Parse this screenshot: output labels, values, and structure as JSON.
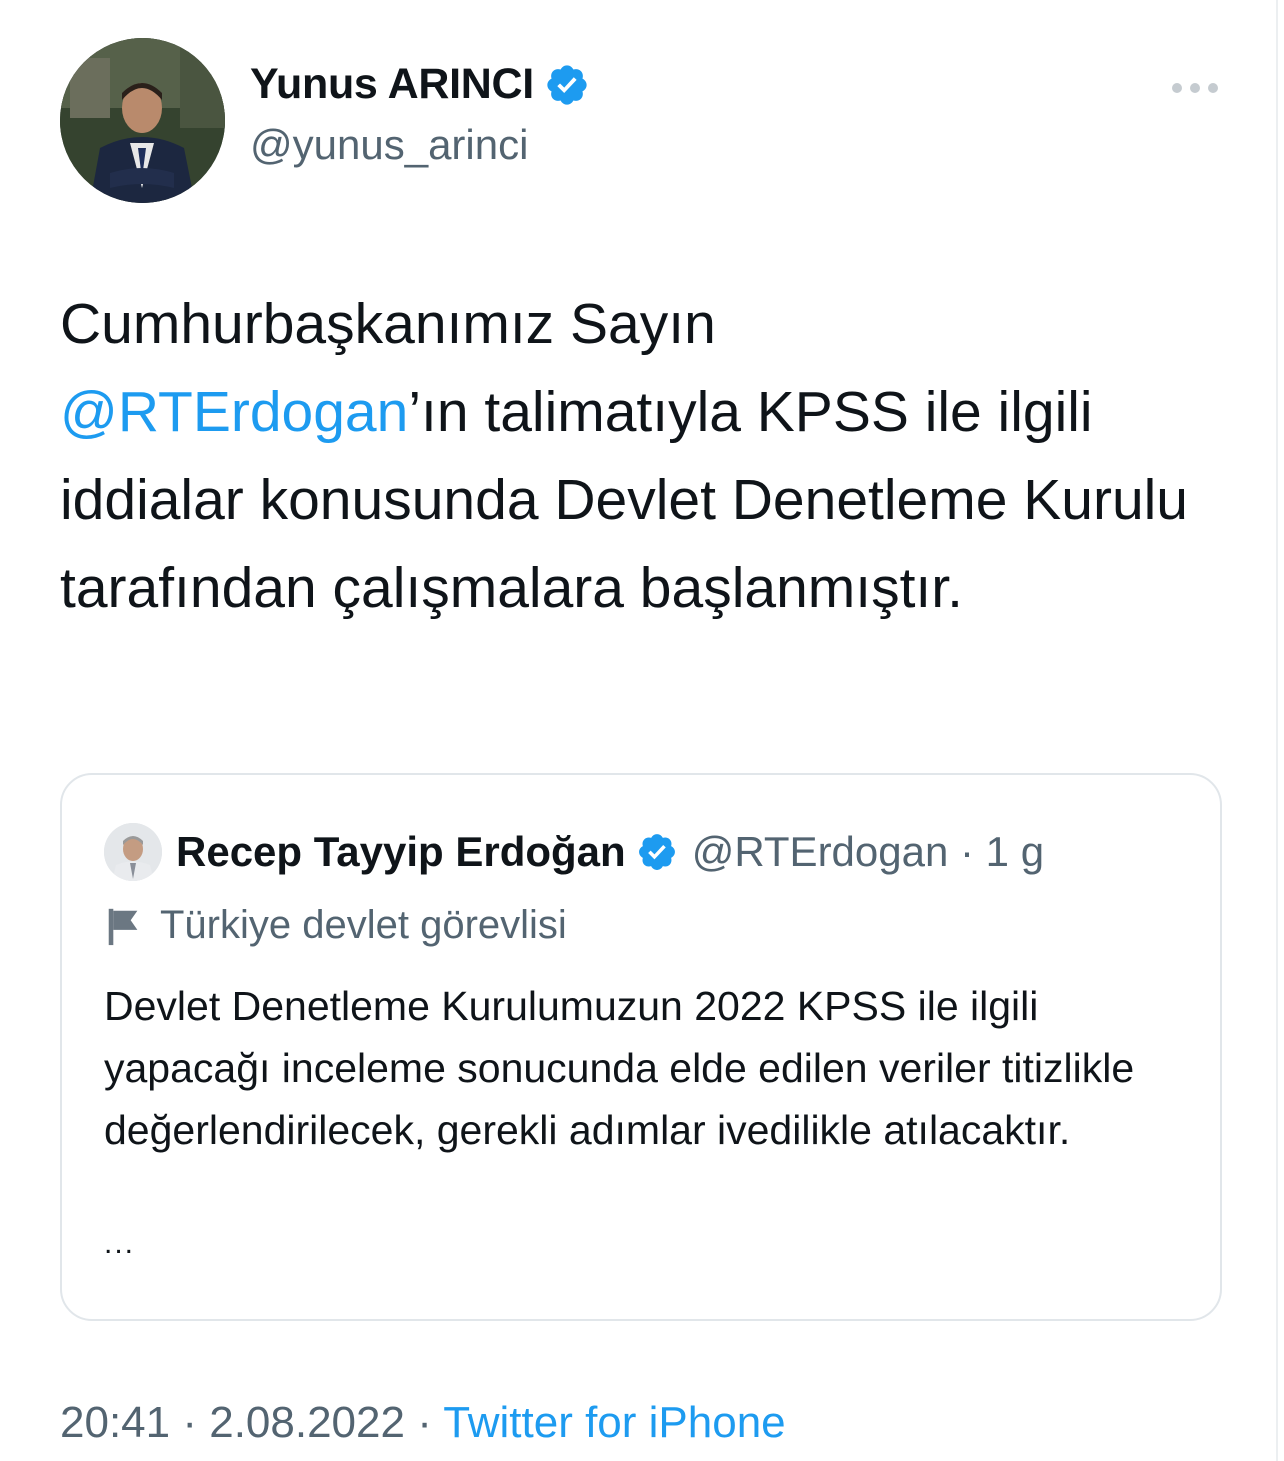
{
  "author": {
    "display_name": "Yunus ARINCI",
    "handle": "@yunus_arinci",
    "verified_icon": "verified-badge-icon",
    "more_icon": "more-horizontal-icon"
  },
  "tweet": {
    "text_before_mention": "Cumhurbaşkanımız Sayın ",
    "mention": "@RTErdogan",
    "text_after_mention": "’ın talimatıyla KPSS ile ilgili iddialar konusunda Devlet Denetleme Kurulu tarafından çalışmalara başlanmıştır."
  },
  "quoted_tweet": {
    "display_name": "Recep Tayyip Erdoğan",
    "handle": "@RTErdogan",
    "separator": " · ",
    "time": "1 g",
    "label_icon": "flag-icon",
    "label": "Türkiye devlet görevlisi",
    "text": "Devlet Denetleme Kurulumuzun 2022 KPSS ile ilgili yapacağı inceleme sonucunda elde edilen veriler titizlikle değerlendirilecek, gerekli adımlar ivedilikle atılacaktır.",
    "ellipsis": "..."
  },
  "footer": {
    "time": "20:41",
    "separator": " · ",
    "date": "2.08.2022",
    "separator2": " · ",
    "source": "Twitter for iPhone"
  },
  "colors": {
    "accent": "#1d9bf0",
    "text": "#0f1419",
    "muted": "#536471",
    "border": "#e1e6ea"
  }
}
